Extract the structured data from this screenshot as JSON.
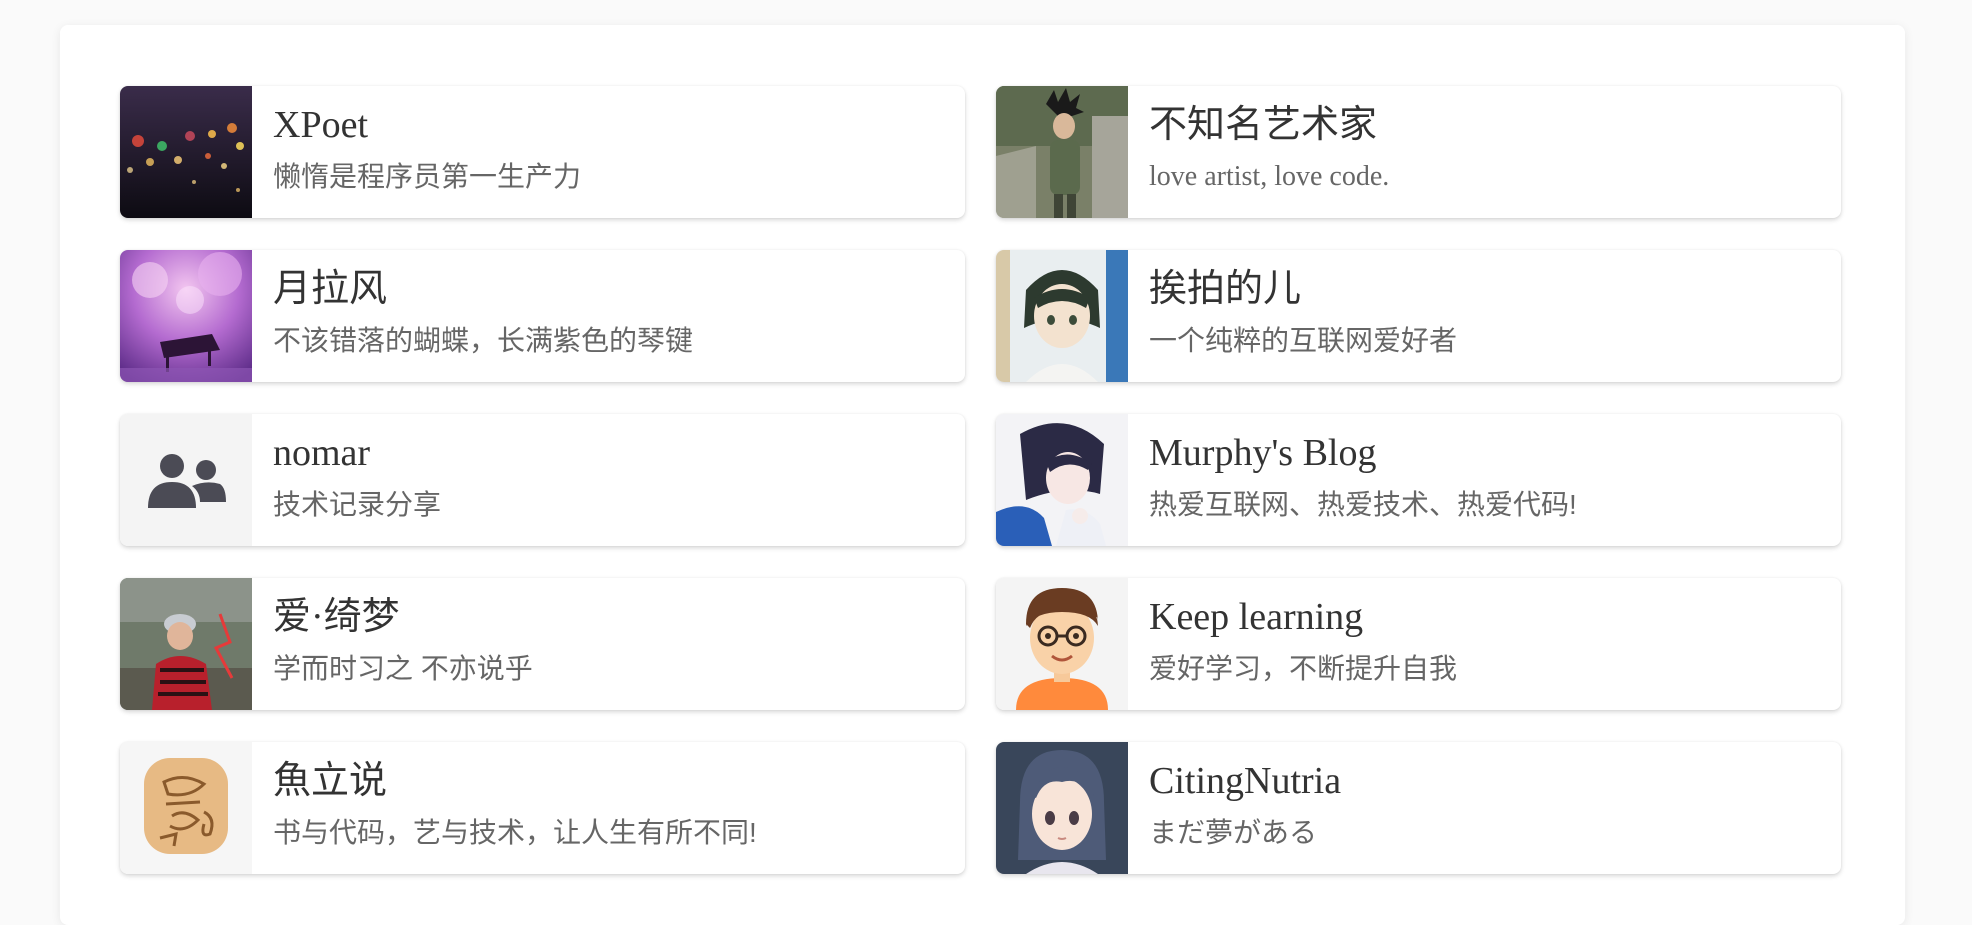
{
  "links": [
    {
      "name": "XPoet",
      "desc": "懒惰是程序员第一生产力",
      "avatar_icon": "bokeh-lights-photo"
    },
    {
      "name": "不知名艺术家",
      "desc": "love artist, love code.",
      "avatar_icon": "goku-cosplay-photo"
    },
    {
      "name": "月拉风",
      "desc": "不该错落的蝴蝶，长满紫色的琴键",
      "avatar_icon": "purple-piano-photo"
    },
    {
      "name": "挨拍的儿",
      "desc": "一个纯粹的互联网爱好者",
      "avatar_icon": "anime-boy-avatar"
    },
    {
      "name": "nomar",
      "desc": "技术记录分享",
      "avatar_icon": "user-group-icon"
    },
    {
      "name": "Murphy's Blog",
      "desc": "热爱互联网、热爱技术、热爱代码!",
      "avatar_icon": "anime-girl-avatar"
    },
    {
      "name": "爱·绮梦",
      "desc": "学而时习之 不亦说乎",
      "avatar_icon": "child-photo"
    },
    {
      "name": "Keep learning",
      "desc": "爱好学习，不断提升自我",
      "avatar_icon": "cartoon-boy-glasses-avatar"
    },
    {
      "name": "魚立说",
      "desc": "书与代码，艺与技术，让人生有所不同!",
      "avatar_icon": "fish-seal-avatar"
    },
    {
      "name": "CitingNutria",
      "desc": "まだ夢がある",
      "avatar_icon": "anime-girl-short-hair-avatar"
    }
  ]
}
